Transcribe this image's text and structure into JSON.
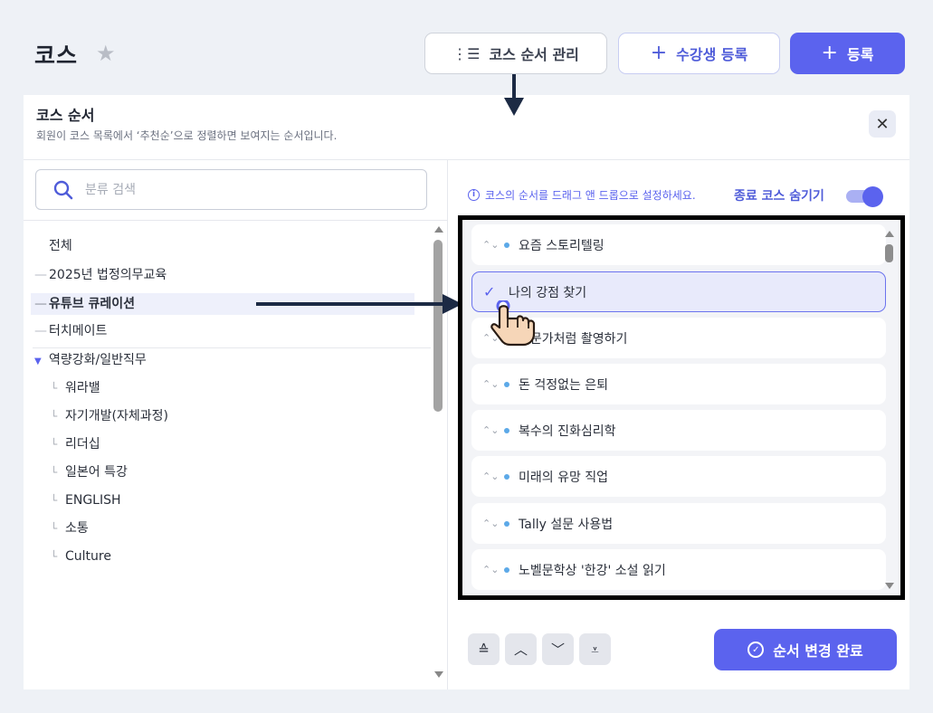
{
  "header": {
    "title": "코스",
    "order_button": "코스 순서 관리",
    "add_student_button": "수강생 등록",
    "register_button": "등록"
  },
  "panel": {
    "title": "코스 순서",
    "subtitle": "회원이 코스 목록에서 ‘추천순’으로 정렬하면 보여지는 순서입니다.",
    "close": "✕"
  },
  "search": {
    "placeholder": "분류 검색"
  },
  "tree": [
    {
      "label": "전체",
      "prefix": ""
    },
    {
      "label": "2025년 법정의무교육",
      "prefix": "—"
    },
    {
      "label": "유튜브 큐레이션",
      "prefix": "—"
    },
    {
      "label": "터치메이트",
      "prefix": "—"
    },
    {
      "label": "역량강화/일반직무",
      "prefix": "▼"
    },
    {
      "label": "워라밸",
      "prefix": "└"
    },
    {
      "label": "자기개발(자체과정)",
      "prefix": "└"
    },
    {
      "label": "리더십",
      "prefix": "└"
    },
    {
      "label": "일본어 특강",
      "prefix": "└"
    },
    {
      "label": "ENGLISH",
      "prefix": "└"
    },
    {
      "label": "소통",
      "prefix": "└"
    },
    {
      "label": "Culture",
      "prefix": "└"
    }
  ],
  "hint": "코스의 순서를 드래그 앤 드롭으로 설정하세요.",
  "toggle_label": "종료 코스 숨기기",
  "toggle_on": true,
  "courses": [
    "요즘 스토리텔링",
    "나의 강점 찾기",
    "전문가처럼 촬영하기",
    "돈 걱정없는 은퇴",
    "복수의 진화심리학",
    "미래의 유망 직업",
    "Tally 설문 사용법",
    "노벨문학상 '한강' 소설 읽기"
  ],
  "selected_course_index": 1,
  "footer": {
    "move_top": "≙",
    "move_up": "︿",
    "move_down": "﹀",
    "move_bottom": "⩡",
    "done_button": "순서 변경 완료"
  },
  "colors": {
    "primary": "#5b63ee",
    "dot": "#5ca9e8",
    "background": "#eef1f6"
  }
}
